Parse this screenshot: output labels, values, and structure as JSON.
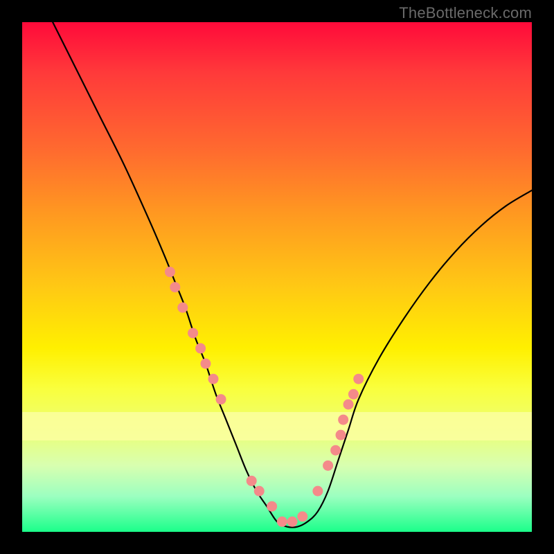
{
  "watermark": {
    "text": "TheBottleneck.com"
  },
  "chart_data": {
    "type": "line",
    "title": "",
    "xlabel": "",
    "ylabel": "",
    "xlim": [
      0,
      100
    ],
    "ylim": [
      0,
      100
    ],
    "grid": false,
    "legend": false,
    "series": [
      {
        "name": "curve",
        "color": "#000000",
        "x": [
          6,
          10,
          15,
          20,
          25,
          28,
          30,
          32,
          34,
          36,
          38,
          40,
          42,
          44,
          46,
          48,
          50,
          52,
          54,
          56,
          58,
          60,
          62,
          64,
          66,
          70,
          75,
          80,
          85,
          90,
          95,
          100
        ],
        "y": [
          100,
          92,
          82,
          72,
          61,
          54,
          49,
          44,
          38,
          33,
          27,
          22,
          17,
          12,
          8,
          5,
          2,
          1,
          1,
          2,
          4,
          8,
          14,
          20,
          26,
          34,
          42,
          49,
          55,
          60,
          64,
          67
        ]
      },
      {
        "name": "dots",
        "color": "#f48a8a",
        "type": "scatter",
        "x": [
          29,
          30,
          31.5,
          33.5,
          35,
          36,
          37.5,
          39,
          45,
          46.5,
          49,
          51,
          53,
          55,
          58,
          60,
          61.5,
          62.5,
          63,
          64,
          65,
          66
        ],
        "y": [
          51,
          48,
          44,
          39,
          36,
          33,
          30,
          26,
          10,
          8,
          5,
          2,
          2,
          3,
          8,
          13,
          16,
          19,
          22,
          25,
          27,
          30
        ]
      }
    ],
    "background_gradient": {
      "type": "vertical",
      "stops": [
        {
          "pos": 0.0,
          "color": "#ff0a3a"
        },
        {
          "pos": 0.1,
          "color": "#ff3a3a"
        },
        {
          "pos": 0.25,
          "color": "#ff6a2f"
        },
        {
          "pos": 0.38,
          "color": "#ff9a20"
        },
        {
          "pos": 0.52,
          "color": "#ffc914"
        },
        {
          "pos": 0.64,
          "color": "#fff000"
        },
        {
          "pos": 0.72,
          "color": "#f9ff3e"
        },
        {
          "pos": 0.8,
          "color": "#ecff75"
        },
        {
          "pos": 0.87,
          "color": "#d8ffb0"
        },
        {
          "pos": 0.93,
          "color": "#9cffc0"
        },
        {
          "pos": 1.0,
          "color": "#1bff8a"
        }
      ]
    },
    "highlight_band": {
      "y_from": 18,
      "y_to": 23.5,
      "color": "#fcffa0"
    }
  }
}
